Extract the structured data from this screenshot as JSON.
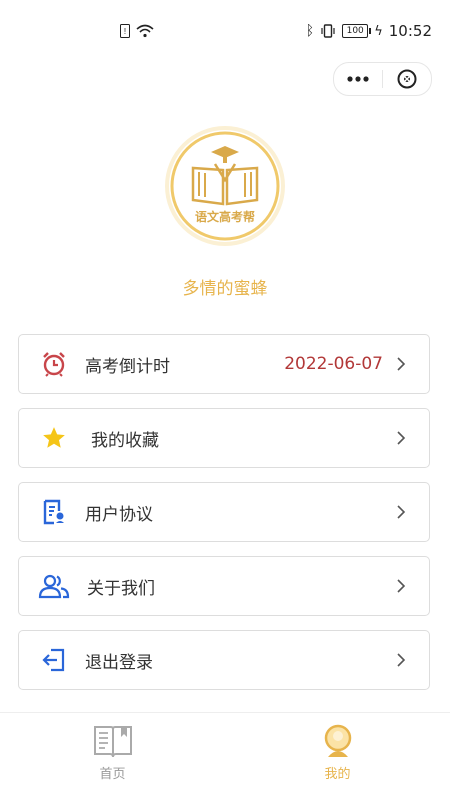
{
  "status_bar": {
    "time": "10:52",
    "battery": "100"
  },
  "capsule": {
    "more_icon": "more-dots-icon",
    "close_icon": "close-circle-icon"
  },
  "profile": {
    "logo_text": "语文高考帮",
    "username": "多情的蜜蜂"
  },
  "menu": {
    "items": [
      {
        "label": "高考倒计时",
        "value": "2022-06-07",
        "icon": "alarm-clock-icon",
        "color": "#c8454a"
      },
      {
        "label": "我的收藏",
        "icon": "star-icon",
        "color": "#f5c518"
      },
      {
        "label": "用户协议",
        "icon": "agreement-icon",
        "color": "#2a66d9"
      },
      {
        "label": "关于我们",
        "icon": "users-icon",
        "color": "#2a66d9"
      },
      {
        "label": "退出登录",
        "icon": "logout-icon",
        "color": "#2a66d9"
      }
    ]
  },
  "tabbar": {
    "tabs": [
      {
        "label": "首页",
        "icon": "book-icon",
        "active": false
      },
      {
        "label": "我的",
        "icon": "profile-icon",
        "active": true
      }
    ],
    "active_color": "#e7b44c",
    "inactive_color": "#999999"
  }
}
